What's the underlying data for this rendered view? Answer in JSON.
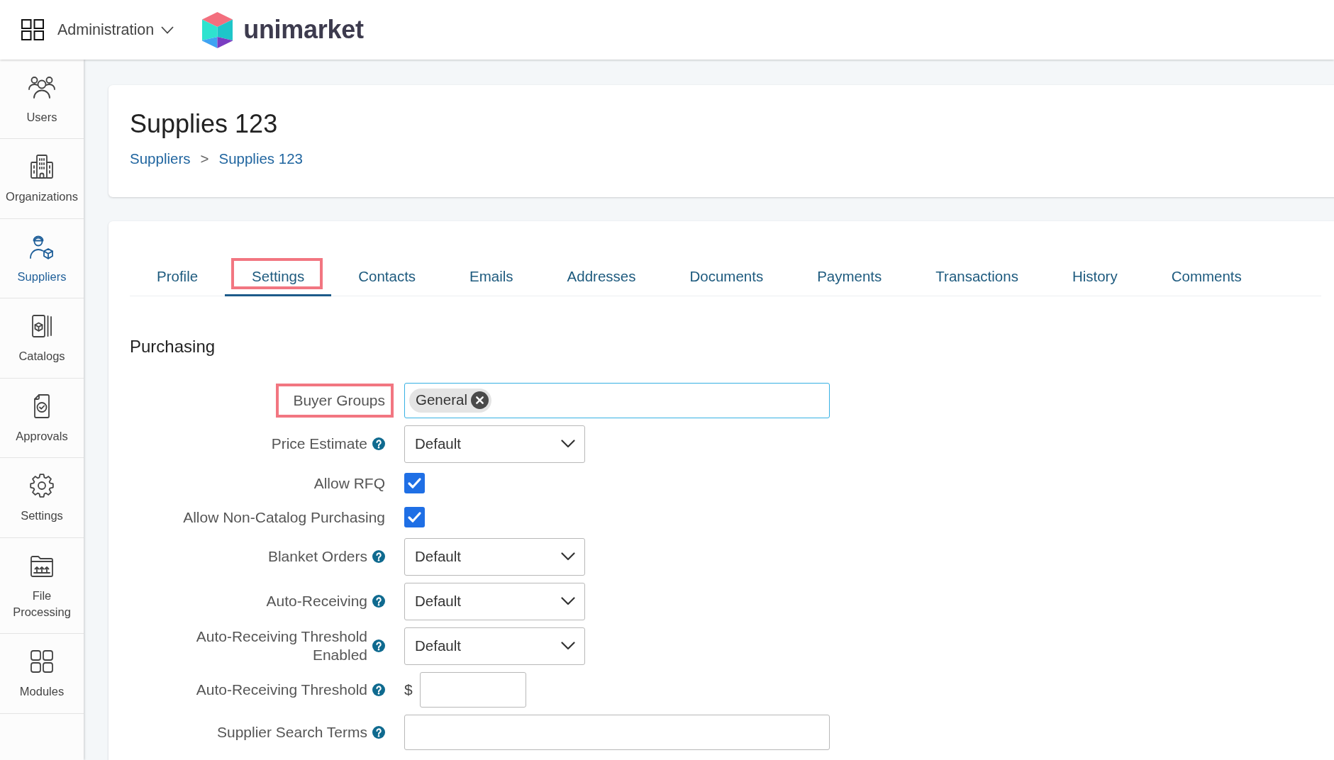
{
  "header": {
    "menu_label": "Administration",
    "brand": "unimarket"
  },
  "sidebar": {
    "items": [
      {
        "label": "Users",
        "selected": false
      },
      {
        "label": "Organizations",
        "selected": false
      },
      {
        "label": "Suppliers",
        "selected": true
      },
      {
        "label": "Catalogs",
        "selected": false
      },
      {
        "label": "Approvals",
        "selected": false
      },
      {
        "label": "Settings",
        "selected": false
      },
      {
        "label": "File Processing",
        "selected": false
      },
      {
        "label": "Modules",
        "selected": false
      }
    ]
  },
  "page": {
    "title": "Supplies 123",
    "breadcrumb": {
      "items": [
        "Suppliers",
        "Supplies 123"
      ],
      "separator": ">"
    }
  },
  "tabs": [
    {
      "label": "Profile",
      "selected": false,
      "highlighted": false
    },
    {
      "label": "Settings",
      "selected": true,
      "highlighted": true
    },
    {
      "label": "Contacts",
      "selected": false,
      "highlighted": false
    },
    {
      "label": "Emails",
      "selected": false,
      "highlighted": false
    },
    {
      "label": "Addresses",
      "selected": false,
      "highlighted": false
    },
    {
      "label": "Documents",
      "selected": false,
      "highlighted": false
    },
    {
      "label": "Payments",
      "selected": false,
      "highlighted": false
    },
    {
      "label": "Transactions",
      "selected": false,
      "highlighted": false
    },
    {
      "label": "History",
      "selected": false,
      "highlighted": false
    },
    {
      "label": "Comments",
      "selected": false,
      "highlighted": false
    }
  ],
  "section": {
    "title": "Purchasing",
    "fields": [
      {
        "kind": "tags",
        "label": "Buyer Groups",
        "help": false,
        "highlighted": true,
        "focused": true,
        "tags": [
          "General"
        ]
      },
      {
        "kind": "select",
        "label": "Price Estimate",
        "help": true,
        "highlighted": false,
        "focused": false,
        "value": "Default"
      },
      {
        "kind": "checkbox",
        "label": "Allow RFQ",
        "help": false,
        "highlighted": false,
        "checked": true
      },
      {
        "kind": "checkbox",
        "label": "Allow Non-Catalog Purchasing",
        "help": false,
        "highlighted": false,
        "checked": true
      },
      {
        "kind": "select",
        "label": "Blanket Orders",
        "help": true,
        "highlighted": false,
        "focused": false,
        "value": "Default"
      },
      {
        "kind": "select",
        "label": "Auto-Receiving",
        "help": true,
        "highlighted": false,
        "focused": false,
        "value": "Default"
      },
      {
        "kind": "select",
        "label": "Auto-Receiving Threshold Enabled",
        "help": true,
        "highlighted": false,
        "focused": false,
        "value": "Default"
      },
      {
        "kind": "currency",
        "label": "Auto-Receiving Threshold",
        "help": true,
        "highlighted": false,
        "focused": false,
        "prefix": "$"
      },
      {
        "kind": "text",
        "label": "Supplier Search Terms",
        "help": true,
        "highlighted": false,
        "focused": false
      }
    ]
  }
}
